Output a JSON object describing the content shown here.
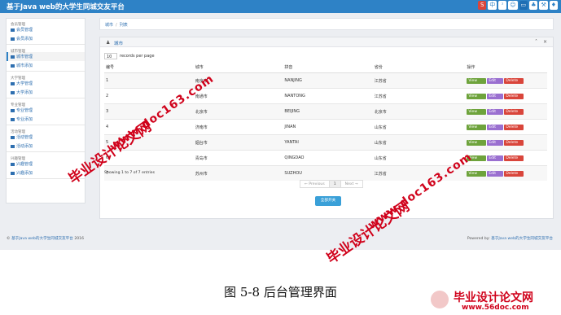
{
  "app": {
    "title": "基于Java web的大学生同城交友平台"
  },
  "tray": [
    "S",
    "中",
    "ᵓ",
    "☺",
    "▭",
    "♣",
    "⚒",
    "♦"
  ],
  "sidebar": {
    "groups": [
      {
        "title": "会员管理",
        "items": [
          "会员管理",
          "会员添加"
        ]
      },
      {
        "title": "城市管理",
        "items": [
          "城市管理",
          "城市添加"
        ]
      },
      {
        "title": "大学管理",
        "items": [
          "大学管理",
          "大学添加"
        ]
      },
      {
        "title": "专业管理",
        "items": [
          "专业管理",
          "专业添加"
        ]
      },
      {
        "title": "活动管理",
        "items": [
          "活动管理",
          "活动添加"
        ]
      },
      {
        "title": "兴趣管理",
        "items": [
          "兴趣管理",
          "兴趣添加"
        ]
      }
    ],
    "active": "城市管理"
  },
  "breadcrumb": {
    "items": [
      "城市",
      "列表"
    ]
  },
  "panel": {
    "title": "城市"
  },
  "table": {
    "page_length": "10",
    "page_length_suffix": "records per page",
    "headers": [
      "编号",
      "城市",
      "拼音",
      "省份",
      "操作"
    ],
    "rows": [
      [
        "1",
        "南京市",
        "NANJING",
        "江苏省"
      ],
      [
        "2",
        "南通市",
        "NANTONG",
        "江苏省"
      ],
      [
        "3",
        "北京市",
        "BEIJING",
        "北京市"
      ],
      [
        "4",
        "济南市",
        "JINAN",
        "山东省"
      ],
      [
        "5",
        "烟台市",
        "YANTAI",
        "山东省"
      ],
      [
        "6",
        "青岛市",
        "QINGDAO",
        "山东省"
      ],
      [
        "7",
        "苏州市",
        "SUZHOU",
        "江苏省"
      ]
    ],
    "actions": {
      "view": "View",
      "edit": "Edit",
      "delete": "Delete"
    },
    "info": "Showing 1 to 7 of 7 entries"
  },
  "pager": {
    "prev": "← Previous",
    "current": "1",
    "next": "Next →"
  },
  "search_button": "全部开关",
  "footer": {
    "copyright_prefix": "© ",
    "copyright_link": "基于Java web的大学生同城交友平台",
    "copyright_suffix": " 2016",
    "powered_prefix": "Powered by: ",
    "powered_link": "基于Java web的大学生同城交友平台"
  },
  "caption": "图 5-8 后台管理界面",
  "watermarks": {
    "cn_text": "毕业设计论文网",
    "url": "www.doc163.com",
    "logo_url": "www.56doc.com"
  }
}
